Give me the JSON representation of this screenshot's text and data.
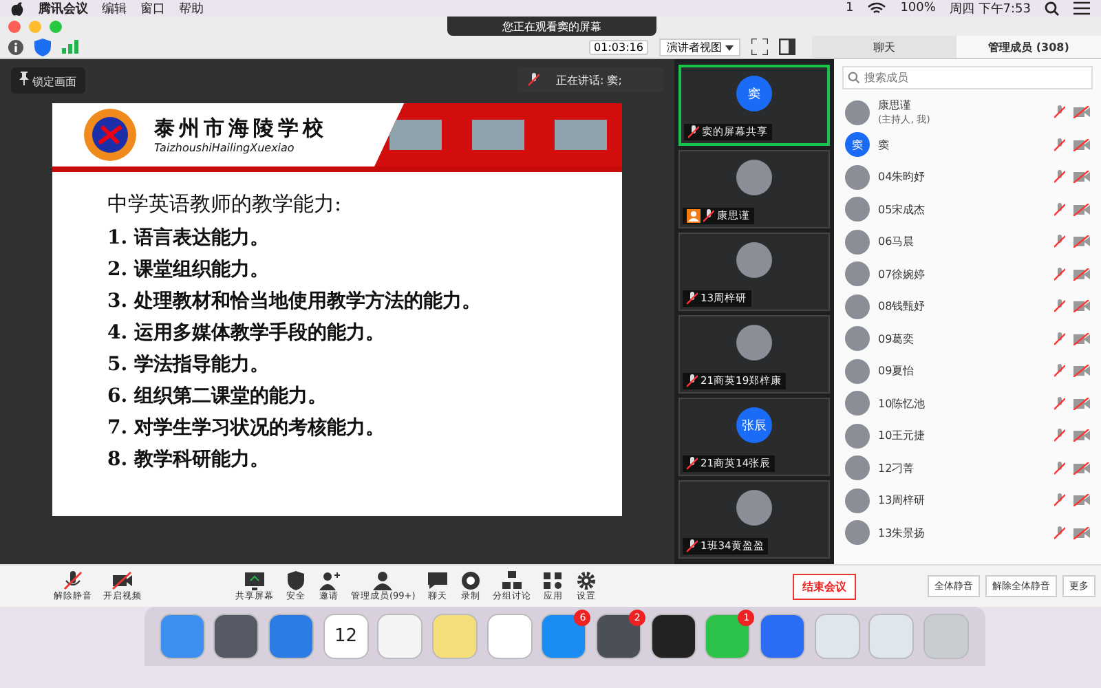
{
  "menubar": {
    "app": "腾讯会议",
    "menus": [
      "编辑",
      "窗口",
      "帮助"
    ],
    "wechat_count": "1",
    "battery": "100%",
    "clock": "周四 下午7:53"
  },
  "window": {
    "banner": "您正在观看窦的屏幕"
  },
  "toolbar": {
    "timer": "01:03:16",
    "view": "演讲者视图",
    "tabs": [
      {
        "label": "聊天",
        "selected": false
      },
      {
        "label": "管理成员 (308)",
        "selected": true
      }
    ]
  },
  "share": {
    "lock_button": "锁定画面",
    "slide": {
      "school": "泰州市海陵学校",
      "school_pinyin": "TaizhoushiHailingXuexiao",
      "title": "中学英语教师的教学能力:",
      "items": [
        "1. 语言表达能力。",
        "2. 课堂组织能力。",
        "3. 处理教材和恰当地使用教学方法的能力。",
        "4. 运用多媒体教学手段的能力。",
        "5. 学法指导能力。",
        "6. 组织第二课堂的能力。",
        "7. 对学生学习状况的考核能力。",
        "8. 教学科研能力。"
      ]
    }
  },
  "videos": [
    {
      "name": "窦的屏幕共享",
      "avatar": "窦",
      "speaking": true,
      "host": false
    },
    {
      "name": "康思谨",
      "speaking": false,
      "host": true
    },
    {
      "name": "13周梓研",
      "speaking": false,
      "host": false
    },
    {
      "name": "21商英19郑梓康",
      "speaking": false,
      "host": false
    },
    {
      "name": "21商英14张辰",
      "avatar": "张辰",
      "speaking": false,
      "host": false
    },
    {
      "name": "1班34黄盈盈",
      "speaking": false,
      "host": false
    }
  ],
  "members": {
    "search_placeholder": "搜索成员",
    "speaking_toast": "正在讲话: 窦;",
    "list": [
      {
        "name": "康思谨",
        "role": "(主持人, 我)"
      },
      {
        "name": "窦",
        "avatar": "窦"
      },
      {
        "name": "04朱昀妤"
      },
      {
        "name": "05宋成杰"
      },
      {
        "name": "06马晨"
      },
      {
        "name": "07徐婉婷"
      },
      {
        "name": "08钱甄妤"
      },
      {
        "name": "09葛奕"
      },
      {
        "name": "09夏怡"
      },
      {
        "name": "10陈忆池"
      },
      {
        "name": "10王元捷"
      },
      {
        "name": "12刁菁"
      },
      {
        "name": "13周梓研"
      },
      {
        "name": "13朱景扬"
      }
    ],
    "buttons": [
      "全体静音",
      "解除全体静音",
      "更多"
    ]
  },
  "controls": [
    {
      "kind": "mic",
      "label": "解除静音"
    },
    {
      "kind": "camera",
      "label": "开启视频"
    },
    {
      "kind": "share",
      "label": "共享屏幕"
    },
    {
      "kind": "shield",
      "label": "安全"
    },
    {
      "kind": "invite",
      "label": "邀请"
    },
    {
      "kind": "members",
      "label": "管理成员(99+)"
    },
    {
      "kind": "chat",
      "label": "聊天"
    },
    {
      "kind": "record",
      "label": "录制"
    },
    {
      "kind": "breakout",
      "label": "分组讨论"
    },
    {
      "kind": "apps",
      "label": "应用"
    },
    {
      "kind": "settings",
      "label": "设置"
    }
  ],
  "end_button": "结束会议",
  "dock": [
    {
      "kind": "finder"
    },
    {
      "kind": "rocket"
    },
    {
      "kind": "compass"
    },
    {
      "kind": "calendar",
      "text": "12"
    },
    {
      "kind": "list"
    },
    {
      "kind": "notes"
    },
    {
      "kind": "doc"
    },
    {
      "kind": "store",
      "badge": "6"
    },
    {
      "kind": "gear",
      "badge": "2"
    },
    {
      "kind": "penguin"
    },
    {
      "kind": "chat",
      "badge": "1"
    },
    {
      "kind": "meeting"
    },
    {
      "kind": "window"
    },
    {
      "kind": "window"
    },
    {
      "kind": "trash"
    }
  ]
}
